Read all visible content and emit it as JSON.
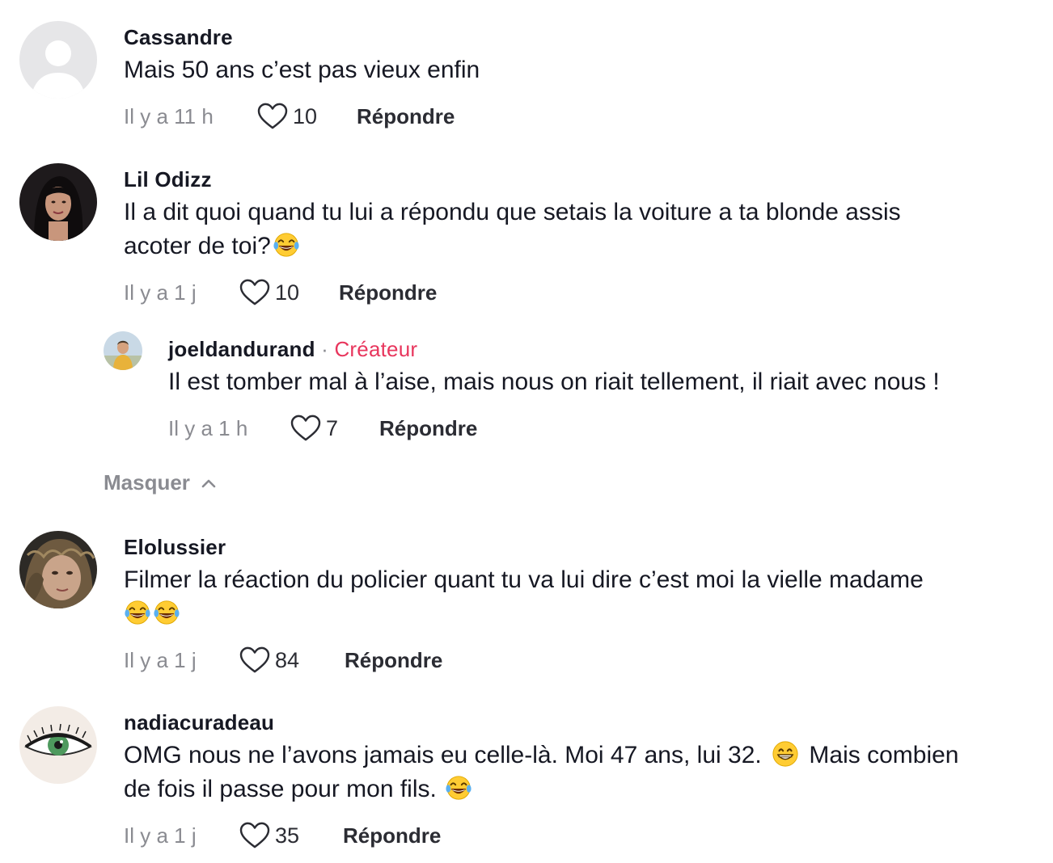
{
  "comments": [
    {
      "username": "Cassandre",
      "text": "Mais 50 ans c’est pas vieux enfin",
      "time": "Il y a 11 h",
      "likes": "10",
      "reply_label": "Répondre"
    },
    {
      "username": "Lil Odizz",
      "text_line1": "Il a dit quoi quand tu lui a répondu que setais la voiture a ta blonde assis",
      "text_line2": "acoter de toi?",
      "time": "Il y a 1 j",
      "likes": "10",
      "reply_label": "Répondre"
    },
    {
      "username": "Elolussier",
      "text": "Filmer la réaction du policier quant tu va lui dire c’est moi la vielle madame",
      "time": "Il y a 1 j",
      "likes": "84",
      "reply_label": "Répondre"
    },
    {
      "username": "nadiacuradeau",
      "text_line1_a": "OMG nous ne l’avons jamais eu celle-là. Moi 47 ans, lui 32.",
      "text_line1_b": "Mais combien",
      "text_line2": "de fois il passe pour mon fils.",
      "time": "Il y a 1 j",
      "likes": "35",
      "reply_label": "Répondre"
    }
  ],
  "reply": {
    "username": "joeldandurand",
    "separator": "·",
    "badge": "Créateur",
    "text": "Il est tomber mal à l’aise, mais nous on riait tellement, il riait avec nous !",
    "time": "Il y a 1 h",
    "likes": "7",
    "reply_label": "Répondre"
  },
  "hide_toggle": {
    "label": "Masquer"
  },
  "icons": {
    "like": "heart-outline-icon",
    "chevron": "chevron-up-icon",
    "emoji_laugh": "face-with-tears-of-joy-emoji",
    "emoji_grin": "grinning-face-emoji"
  },
  "colors": {
    "text": "#161823",
    "muted": "#8a8b91",
    "creator_badge": "#e8365d",
    "background": "#ffffff"
  }
}
